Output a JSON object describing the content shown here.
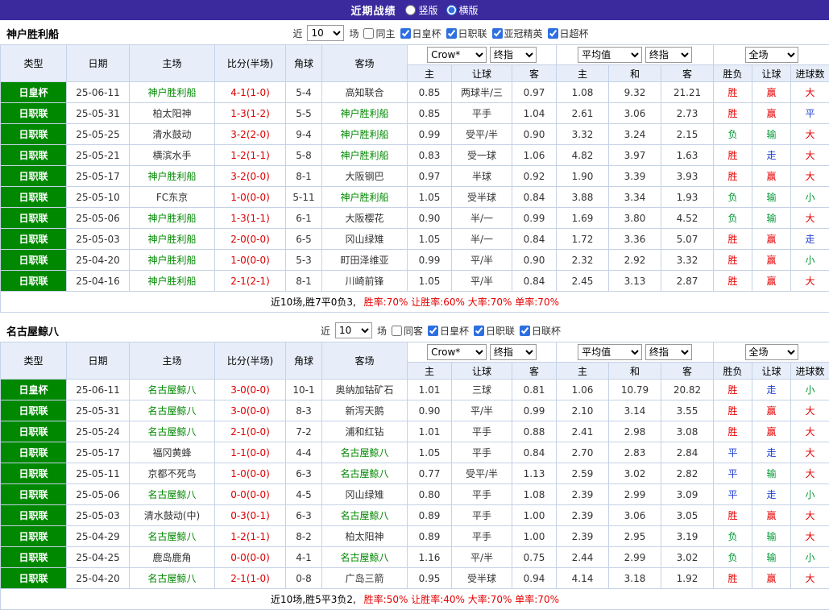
{
  "topbar": {
    "title": "近期战绩",
    "radios": [
      {
        "label": "竖版",
        "selected": false
      },
      {
        "label": "横版",
        "selected": true
      }
    ]
  },
  "header": {
    "static_cols": [
      "类型",
      "日期",
      "主场",
      "比分(半场)",
      "角球",
      "客场"
    ],
    "asian_select": "Crow*",
    "asian_final_select": "终指",
    "asian_sub": [
      "主",
      "让球",
      "客"
    ],
    "euro_select": "平均值",
    "euro_final_select": "终指",
    "euro_sub": [
      "主",
      "和",
      "客"
    ],
    "result_select": "全场",
    "result_sub": [
      "胜负",
      "让球",
      "进球数"
    ]
  },
  "result_color_map": {
    "胜": "red",
    "平": "blue",
    "负": "green",
    "赢": "red",
    "走": "blue",
    "输": "green",
    "大": "red",
    "小": "green"
  },
  "colors": {
    "topbar_bg": "#3b2a9d",
    "type_badge_green": "#008800",
    "focal_team_green": "#008800",
    "score_red": "#dd0000",
    "win_red": "#e60000",
    "lose_green": "#009933",
    "push_blue": "#1f3fd0",
    "header_bg": "#e7eef9",
    "grid_line": "#c5d2e6"
  },
  "sections": [
    {
      "team": "神户胜利船",
      "filter": {
        "prefix": "近",
        "count": "10",
        "suffix": "场",
        "same": {
          "label": "同主",
          "checked": false
        },
        "leagues": [
          {
            "label": "日皇杯",
            "checked": true
          },
          {
            "label": "日职联",
            "checked": true
          },
          {
            "label": "亚冠精英",
            "checked": true
          },
          {
            "label": "日超杯",
            "checked": true
          }
        ]
      },
      "rows": [
        {
          "type": "日皇杯",
          "date": "25-06-11",
          "home": "神户胜利船",
          "home_focal": true,
          "score": "4-1(1-0)",
          "corner": "5-4",
          "away": "高知联合",
          "o1": "0.85",
          "hcap": "两球半/三",
          "o2": "0.97",
          "e1": "1.08",
          "e2": "9.32",
          "e3": "21.21",
          "r1": "胜",
          "r2": "赢",
          "r3": "大"
        },
        {
          "type": "日职联",
          "date": "25-05-31",
          "home": "柏太阳神",
          "score": "1-3(1-2)",
          "corner": "5-5",
          "away": "神户胜利船",
          "away_focal": true,
          "o1": "0.85",
          "hcap": "平手",
          "o2": "1.04",
          "e1": "2.61",
          "e2": "3.06",
          "e3": "2.73",
          "r1": "胜",
          "r2": "赢",
          "r3": "平"
        },
        {
          "type": "日职联",
          "date": "25-05-25",
          "home": "清水鼓动",
          "score": "3-2(2-0)",
          "corner": "9-4",
          "away": "神户胜利船",
          "away_focal": true,
          "o1": "0.99",
          "hcap": "受平/半",
          "o2": "0.90",
          "e1": "3.32",
          "e2": "3.24",
          "e3": "2.15",
          "r1": "负",
          "r2": "输",
          "r3": "大"
        },
        {
          "type": "日职联",
          "date": "25-05-21",
          "home": "横滨水手",
          "score": "1-2(1-1)",
          "corner": "5-8",
          "away": "神户胜利船",
          "away_focal": true,
          "o1": "0.83",
          "hcap": "受一球",
          "o2": "1.06",
          "e1": "4.82",
          "e2": "3.97",
          "e3": "1.63",
          "r1": "胜",
          "r2": "走",
          "r3": "大"
        },
        {
          "type": "日职联",
          "date": "25-05-17",
          "home": "神户胜利船",
          "home_focal": true,
          "score": "3-2(0-0)",
          "corner": "8-1",
          "away": "大阪钢巴",
          "o1": "0.97",
          "hcap": "半球",
          "o2": "0.92",
          "e1": "1.90",
          "e2": "3.39",
          "e3": "3.93",
          "r1": "胜",
          "r2": "赢",
          "r3": "大"
        },
        {
          "type": "日职联",
          "date": "25-05-10",
          "home": "FC东京",
          "score": "1-0(0-0)",
          "corner": "5-11",
          "away": "神户胜利船",
          "away_focal": true,
          "o1": "1.05",
          "hcap": "受半球",
          "o2": "0.84",
          "e1": "3.88",
          "e2": "3.34",
          "e3": "1.93",
          "r1": "负",
          "r2": "输",
          "r3": "小"
        },
        {
          "type": "日职联",
          "date": "25-05-06",
          "home": "神户胜利船",
          "home_focal": true,
          "score": "1-3(1-1)",
          "corner": "6-1",
          "away": "大阪樱花",
          "o1": "0.90",
          "hcap": "半/一",
          "o2": "0.99",
          "e1": "1.69",
          "e2": "3.80",
          "e3": "4.52",
          "r1": "负",
          "r2": "输",
          "r3": "大"
        },
        {
          "type": "日职联",
          "date": "25-05-03",
          "home": "神户胜利船",
          "home_focal": true,
          "score": "2-0(0-0)",
          "corner": "6-5",
          "away": "冈山绿雉",
          "o1": "1.05",
          "hcap": "半/一",
          "o2": "0.84",
          "e1": "1.72",
          "e2": "3.36",
          "e3": "5.07",
          "r1": "胜",
          "r2": "赢",
          "r3": "走"
        },
        {
          "type": "日职联",
          "date": "25-04-20",
          "home": "神户胜利船",
          "home_focal": true,
          "score": "1-0(0-0)",
          "corner": "5-3",
          "away": "町田泽维亚",
          "o1": "0.99",
          "hcap": "平/半",
          "o2": "0.90",
          "e1": "2.32",
          "e2": "2.92",
          "e3": "3.32",
          "r1": "胜",
          "r2": "赢",
          "r3": "小"
        },
        {
          "type": "日职联",
          "date": "25-04-16",
          "home": "神户胜利船",
          "home_focal": true,
          "score": "2-1(2-1)",
          "corner": "8-1",
          "away": "川崎前锋",
          "o1": "1.05",
          "hcap": "平/半",
          "o2": "0.84",
          "e1": "2.45",
          "e2": "3.13",
          "e3": "2.87",
          "r1": "胜",
          "r2": "赢",
          "r3": "大"
        }
      ],
      "summary": {
        "prefix": "近10场,胜7平0负3,",
        "stats": "胜率:70% 让胜率:60% 大率:70% 单率:70%"
      }
    },
    {
      "team": "名古屋鲸八",
      "filter": {
        "prefix": "近",
        "count": "10",
        "suffix": "场",
        "same": {
          "label": "同客",
          "checked": false
        },
        "leagues": [
          {
            "label": "日皇杯",
            "checked": true
          },
          {
            "label": "日职联",
            "checked": true
          },
          {
            "label": "日联杯",
            "checked": true
          }
        ]
      },
      "rows": [
        {
          "type": "日皇杯",
          "date": "25-06-11",
          "home": "名古屋鲸八",
          "home_focal": true,
          "score": "3-0(0-0)",
          "corner": "10-1",
          "away": "奥纳加钴矿石",
          "o1": "1.01",
          "hcap": "三球",
          "o2": "0.81",
          "e1": "1.06",
          "e2": "10.79",
          "e3": "20.82",
          "r1": "胜",
          "r2": "走",
          "r3": "小"
        },
        {
          "type": "日职联",
          "date": "25-05-31",
          "home": "名古屋鲸八",
          "home_focal": true,
          "score": "3-0(0-0)",
          "corner": "8-3",
          "away": "新泻天鹅",
          "o1": "0.90",
          "hcap": "平/半",
          "o2": "0.99",
          "e1": "2.10",
          "e2": "3.14",
          "e3": "3.55",
          "r1": "胜",
          "r2": "赢",
          "r3": "大"
        },
        {
          "type": "日职联",
          "date": "25-05-24",
          "home": "名古屋鲸八",
          "home_focal": true,
          "score": "2-1(0-0)",
          "corner": "7-2",
          "away": "浦和红钻",
          "o1": "1.01",
          "hcap": "平手",
          "o2": "0.88",
          "e1": "2.41",
          "e2": "2.98",
          "e3": "3.08",
          "r1": "胜",
          "r2": "赢",
          "r3": "大"
        },
        {
          "type": "日职联",
          "date": "25-05-17",
          "home": "福冈黄蜂",
          "score": "1-1(0-0)",
          "corner": "4-4",
          "away": "名古屋鲸八",
          "away_focal": true,
          "o1": "1.05",
          "hcap": "平手",
          "o2": "0.84",
          "e1": "2.70",
          "e2": "2.83",
          "e3": "2.84",
          "r1": "平",
          "r2": "走",
          "r3": "大"
        },
        {
          "type": "日职联",
          "date": "25-05-11",
          "home": "京都不死鸟",
          "score": "1-0(0-0)",
          "corner": "6-3",
          "away": "名古屋鲸八",
          "away_focal": true,
          "o1": "0.77",
          "hcap": "受平/半",
          "o2": "1.13",
          "e1": "2.59",
          "e2": "3.02",
          "e3": "2.82",
          "r1": "平",
          "r2": "输",
          "r3": "大"
        },
        {
          "type": "日职联",
          "date": "25-05-06",
          "home": "名古屋鲸八",
          "home_focal": true,
          "score": "0-0(0-0)",
          "corner": "4-5",
          "away": "冈山绿雉",
          "o1": "0.80",
          "hcap": "平手",
          "o2": "1.08",
          "e1": "2.39",
          "e2": "2.99",
          "e3": "3.09",
          "r1": "平",
          "r2": "走",
          "r3": "小"
        },
        {
          "type": "日职联",
          "date": "25-05-03",
          "home": "清水鼓动(中)",
          "score": "0-3(0-1)",
          "corner": "6-3",
          "away": "名古屋鲸八",
          "away_focal": true,
          "o1": "0.89",
          "hcap": "平手",
          "o2": "1.00",
          "e1": "2.39",
          "e2": "3.06",
          "e3": "3.05",
          "r1": "胜",
          "r2": "赢",
          "r3": "大"
        },
        {
          "type": "日职联",
          "date": "25-04-29",
          "home": "名古屋鲸八",
          "home_focal": true,
          "score": "1-2(1-1)",
          "corner": "8-2",
          "away": "柏太阳神",
          "o1": "0.89",
          "hcap": "平手",
          "o2": "1.00",
          "e1": "2.39",
          "e2": "2.95",
          "e3": "3.19",
          "r1": "负",
          "r2": "输",
          "r3": "大"
        },
        {
          "type": "日职联",
          "date": "25-04-25",
          "home": "鹿岛鹿角",
          "score": "0-0(0-0)",
          "corner": "4-1",
          "away": "名古屋鲸八",
          "away_focal": true,
          "o1": "1.16",
          "hcap": "平/半",
          "o2": "0.75",
          "e1": "2.44",
          "e2": "2.99",
          "e3": "3.02",
          "r1": "负",
          "r2": "输",
          "r3": "小"
        },
        {
          "type": "日职联",
          "date": "25-04-20",
          "home": "名古屋鲸八",
          "home_focal": true,
          "score": "2-1(1-0)",
          "corner": "0-8",
          "away": "广岛三箭",
          "o1": "0.95",
          "hcap": "受半球",
          "o2": "0.94",
          "e1": "4.14",
          "e2": "3.18",
          "e3": "1.92",
          "r1": "胜",
          "r2": "赢",
          "r3": "大"
        }
      ],
      "summary": {
        "prefix": "近10场,胜5平3负2,",
        "stats": "胜率:50% 让胜率:40% 大率:70% 单率:70%"
      }
    }
  ]
}
